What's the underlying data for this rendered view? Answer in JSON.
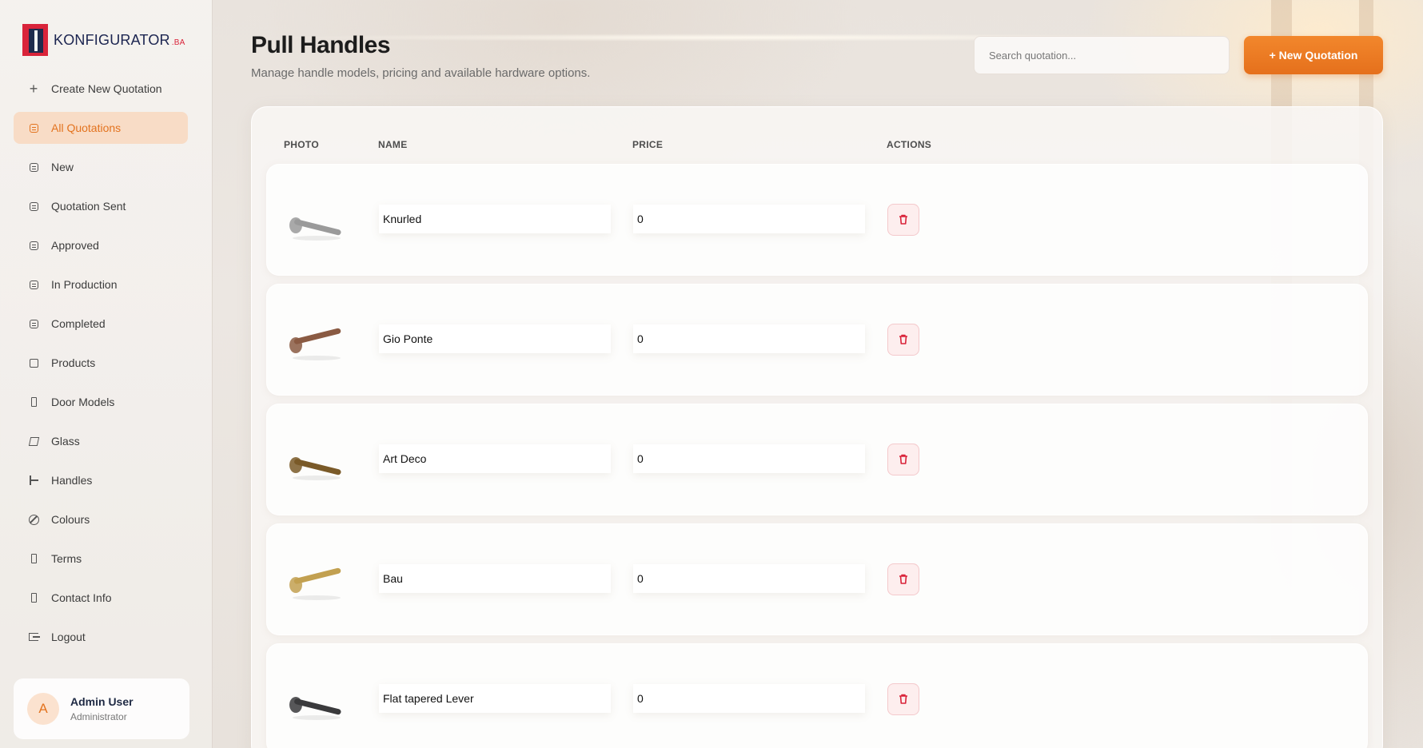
{
  "brand": {
    "name": "KONFIGURATOR",
    "suffix": ".BA"
  },
  "sidebar": {
    "items": [
      {
        "label": "Create New Quotation",
        "icon": "plus-icon",
        "active": false
      },
      {
        "label": "All Quotations",
        "icon": "document-icon",
        "active": true
      },
      {
        "label": "New",
        "icon": "document-icon",
        "active": false
      },
      {
        "label": "Quotation Sent",
        "icon": "document-icon",
        "active": false
      },
      {
        "label": "Approved",
        "icon": "document-icon",
        "active": false
      },
      {
        "label": "In Production",
        "icon": "document-icon",
        "active": false
      },
      {
        "label": "Completed",
        "icon": "document-icon",
        "active": false
      },
      {
        "label": "Products",
        "icon": "box-icon",
        "active": false
      },
      {
        "label": "Door Models",
        "icon": "door-icon",
        "active": false
      },
      {
        "label": "Glass",
        "icon": "glass-icon",
        "active": false
      },
      {
        "label": "Handles",
        "icon": "handle-icon",
        "active": false
      },
      {
        "label": "Colours",
        "icon": "ban-icon",
        "active": false
      },
      {
        "label": "Terms",
        "icon": "door-icon",
        "active": false
      },
      {
        "label": "Contact Info",
        "icon": "door-icon",
        "active": false
      },
      {
        "label": "Logout",
        "icon": "logout-icon",
        "active": false
      }
    ]
  },
  "user": {
    "initial": "A",
    "name": "Admin User",
    "role": "Administrator"
  },
  "header": {
    "title": "Pull Handles",
    "subtitle": "Manage handle models, pricing and available hardware options.",
    "search_placeholder": "Search quotation...",
    "new_button": "+ New Quotation"
  },
  "table": {
    "columns": [
      "PHOTO",
      "NAME",
      "PRICE",
      "ACTIONS"
    ],
    "rows": [
      {
        "name": "Knurled",
        "price": "0",
        "finish": "satin-steel",
        "color": "#9a9a9a"
      },
      {
        "name": "Gio Ponte",
        "price": "0",
        "finish": "copper",
        "color": "#8a5a42"
      },
      {
        "name": "Art Deco",
        "price": "0",
        "finish": "bronze",
        "color": "#7a5a28"
      },
      {
        "name": "Bau",
        "price": "0",
        "finish": "brass",
        "color": "#c2a050"
      },
      {
        "name": "Flat tapered Lever",
        "price": "0",
        "finish": "black",
        "color": "#3a3a3c"
      }
    ]
  },
  "colors": {
    "accent": "#e5701c",
    "active_bg": "#f8dcc6",
    "danger": "#d9243a"
  }
}
